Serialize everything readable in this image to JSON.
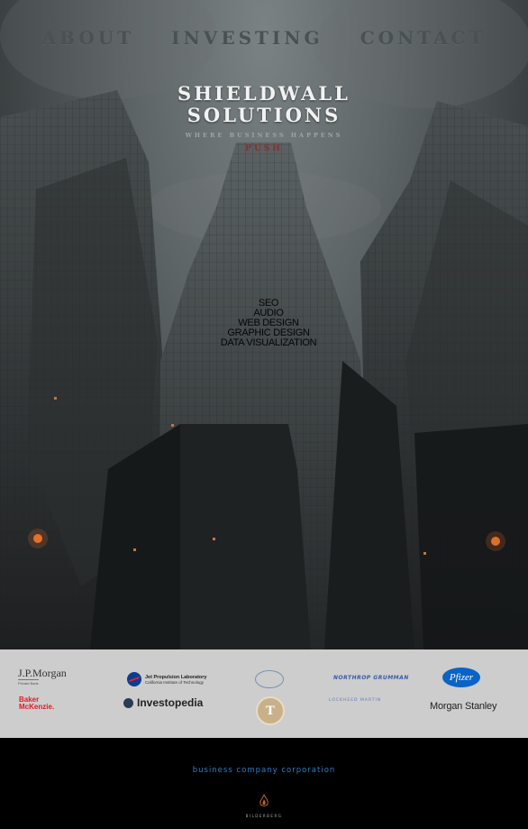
{
  "nav": {
    "items": [
      {
        "label": "ABOUT"
      },
      {
        "label": "INVESTING"
      },
      {
        "label": "CONTACT"
      }
    ]
  },
  "brand": {
    "line1": "SHIELDWALL",
    "line2": "SOLUTIONS",
    "tagline": "WHERE BUSINESS HAPPENS",
    "push": "PUSH"
  },
  "services": [
    "SEO",
    "AUDIO",
    "WEB DESIGN",
    "GRAPHIC DESIGN",
    "DATA VISUALIZATION"
  ],
  "logos": {
    "jpmorgan": {
      "name": "J.P.Morgan",
      "sub": "Private Bank"
    },
    "jpl": {
      "title": "Jet Propulsion Laboratory",
      "subtitle": "California Institute of Technology"
    },
    "aerospace": "NORTHROP GRUMMAN",
    "pfizer": "Pfizer",
    "baker": {
      "line1": "Baker",
      "line2": "McKenzie."
    },
    "investopedia": "Investopedia",
    "seal_letter": "T",
    "lockheed": "LOCKHEED MARTIN",
    "morgan_stanley": "Morgan Stanley"
  },
  "footer": {
    "tagline": "business company corporation",
    "brand": "BILDERBERG"
  },
  "colors": {
    "nav_text": "#4a5152",
    "push_red": "#8e2c2c",
    "logo_strip": "#cdcdcd",
    "footer_bg": "#000000",
    "tagline_blue": "#2f7fc4"
  }
}
